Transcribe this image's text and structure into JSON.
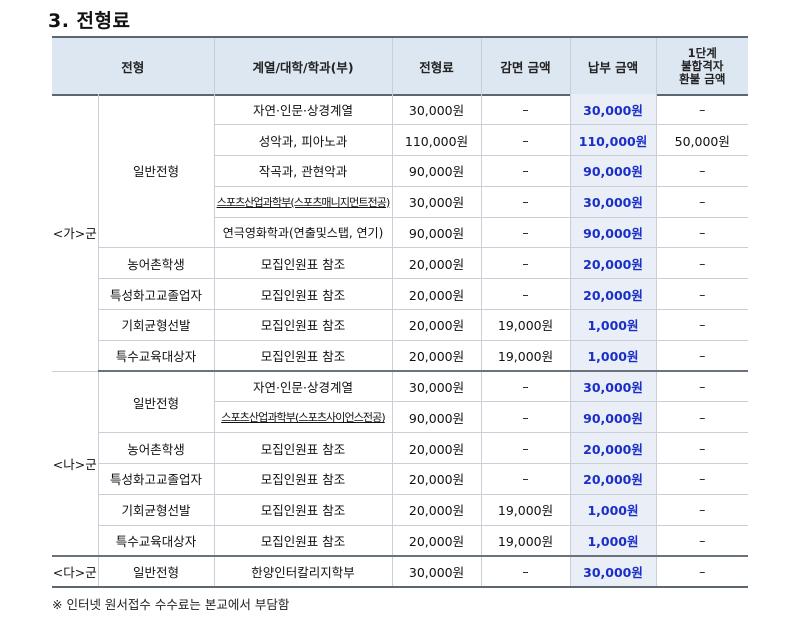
{
  "title": "3. 전형료",
  "headers": {
    "type": "전형",
    "dept": "계열/대학/학과(부)",
    "fee": "전형료",
    "discount": "감면 금액",
    "pay": "납부 금액",
    "refund_l1": "1단계",
    "refund_l2": "불합격자",
    "refund_l3": "환불 금액"
  },
  "groups": {
    "ga": "<가>군",
    "na": "<나>군",
    "da": "<다>군"
  },
  "rows": [
    {
      "type": "일반전형",
      "dept": "자연·인문·상경계열",
      "fee": "30,000원",
      "discount": "–",
      "pay": "30,000원",
      "refund": "–"
    },
    {
      "dept": "성악과,  피아노과",
      "fee": "110,000원",
      "discount": "–",
      "pay": "110,000원",
      "refund": "50,000원"
    },
    {
      "dept": "작곡과,  관현악과",
      "fee": "90,000원",
      "discount": "–",
      "pay": "90,000원",
      "refund": "–"
    },
    {
      "dept": "스포츠산업과학부(스포츠매니지먼트전공)",
      "fee": "30,000원",
      "discount": "–",
      "pay": "30,000원",
      "refund": "–"
    },
    {
      "dept": "연극영화학과(연출및스탭,  연기)",
      "fee": "90,000원",
      "discount": "–",
      "pay": "90,000원",
      "refund": "–"
    },
    {
      "type": "농어촌학생",
      "dept": "모집인원표  참조",
      "fee": "20,000원",
      "discount": "–",
      "pay": "20,000원",
      "refund": "–"
    },
    {
      "type": "특성화고교졸업자",
      "dept": "모집인원표  참조",
      "fee": "20,000원",
      "discount": "–",
      "pay": "20,000원",
      "refund": "–"
    },
    {
      "type": "기회균형선발",
      "dept": "모집인원표  참조",
      "fee": "20,000원",
      "discount": "19,000원",
      "pay": "1,000원",
      "refund": "–"
    },
    {
      "type": "특수교육대상자",
      "dept": "모집인원표  참조",
      "fee": "20,000원",
      "discount": "19,000원",
      "pay": "1,000원",
      "refund": "–"
    },
    {
      "type": "일반전형",
      "dept": "자연·인문·상경계열",
      "fee": "30,000원",
      "discount": "–",
      "pay": "30,000원",
      "refund": "–"
    },
    {
      "dept": "스포츠산업과학부(스포츠사이언스전공)",
      "fee": "90,000원",
      "discount": "–",
      "pay": "90,000원",
      "refund": "–"
    },
    {
      "type": "농어촌학생",
      "dept": "모집인원표  참조",
      "fee": "20,000원",
      "discount": "–",
      "pay": "20,000원",
      "refund": "–"
    },
    {
      "type": "특성화고교졸업자",
      "dept": "모집인원표  참조",
      "fee": "20,000원",
      "discount": "–",
      "pay": "20,000원",
      "refund": "–"
    },
    {
      "type": "기회균형선발",
      "dept": "모집인원표  참조",
      "fee": "20,000원",
      "discount": "19,000원",
      "pay": "1,000원",
      "refund": "–"
    },
    {
      "type": "특수교육대상자",
      "dept": "모집인원표  참조",
      "fee": "20,000원",
      "discount": "19,000원",
      "pay": "1,000원",
      "refund": "–"
    },
    {
      "type": "일반전형",
      "dept": "한양인터칼리지학부",
      "fee": "30,000원",
      "discount": "–",
      "pay": "30,000원",
      "refund": "–"
    }
  ],
  "note": "※  인터넷  원서접수  수수료는  본교에서  부담함"
}
